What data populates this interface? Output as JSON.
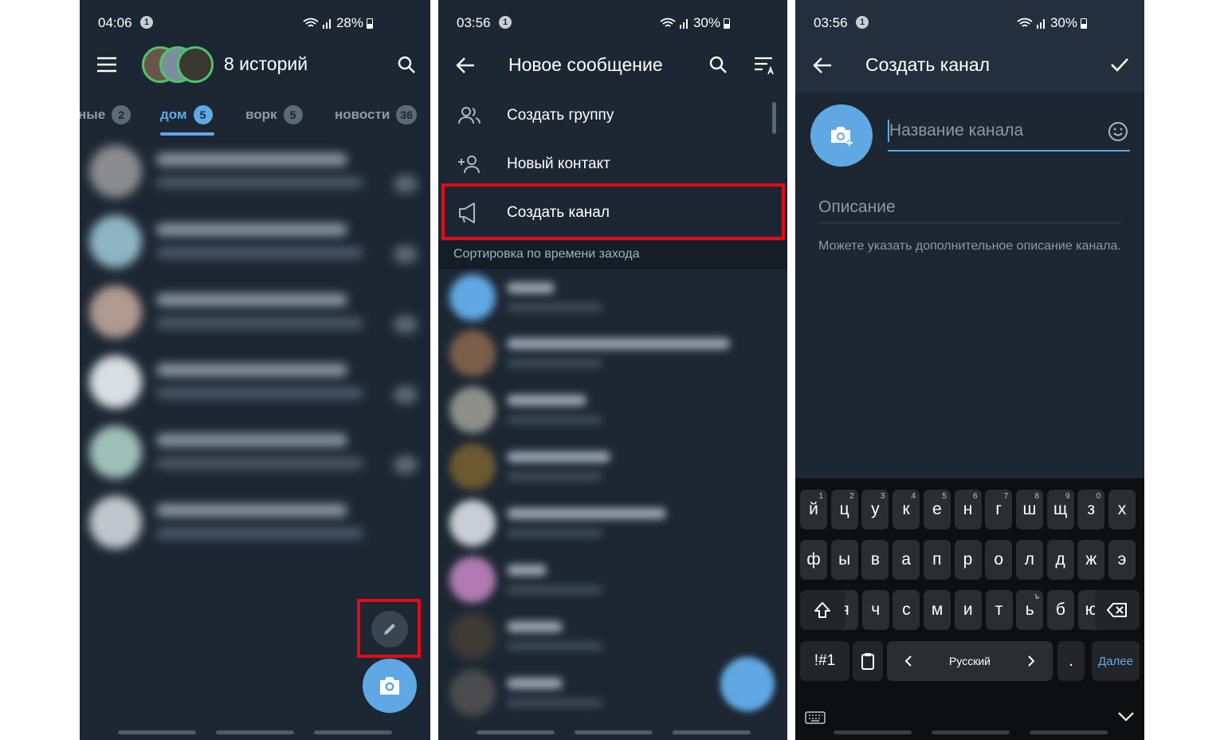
{
  "screens": {
    "chats": {
      "status": {
        "time": "04:06",
        "notif_count": "1",
        "battery": "28%"
      },
      "title": "8 историй",
      "tabs": [
        {
          "label": "ные",
          "count": "2"
        },
        {
          "label": "дом",
          "count": "5"
        },
        {
          "label": "ворк",
          "count": "5"
        },
        {
          "label": "новости",
          "count": "36"
        }
      ]
    },
    "new_message": {
      "status": {
        "time": "03:56",
        "notif_count": "1",
        "battery": "30%"
      },
      "title": "Новое сообщение",
      "menu": [
        {
          "label": "Создать группу",
          "icon": "group-icon"
        },
        {
          "label": "Новый контакт",
          "icon": "add-contact-icon"
        },
        {
          "label": "Создать канал",
          "icon": "megaphone-icon"
        }
      ],
      "section_header": "Сортировка по времени захода"
    },
    "create_channel": {
      "status": {
        "time": "03:56",
        "notif_count": "1",
        "battery": "30%"
      },
      "title": "Создать канал",
      "name_placeholder": "Название канала",
      "description_placeholder": "Описание",
      "description_hint": "Можете указать дополнительное описание канала.",
      "keyboard": {
        "row1": [
          [
            "й",
            "1"
          ],
          [
            "ц",
            "2"
          ],
          [
            "у",
            "3"
          ],
          [
            "к",
            "4"
          ],
          [
            "е",
            "5"
          ],
          [
            "н",
            "6"
          ],
          [
            "г",
            "7"
          ],
          [
            "ш",
            "8"
          ],
          [
            "щ",
            "9"
          ],
          [
            "з",
            "0"
          ],
          [
            "х",
            ""
          ]
        ],
        "row2": [
          "ф",
          "ы",
          "в",
          "а",
          "п",
          "р",
          "о",
          "л",
          "д",
          "ж",
          "э"
        ],
        "row3": [
          [
            "я",
            ""
          ],
          [
            "ч",
            ""
          ],
          [
            "с",
            ""
          ],
          [
            "м",
            ""
          ],
          [
            "и",
            ""
          ],
          [
            "т",
            ""
          ],
          [
            "ь",
            "ъ"
          ],
          [
            "б",
            ""
          ],
          [
            "ю",
            ""
          ]
        ],
        "symbols_label": "!#1",
        "language_label": "Русский",
        "period_label": ".",
        "next_label": "Далее"
      }
    }
  },
  "colors": {
    "accent": "#5ea9e6",
    "background": "#1d2733",
    "highlight": "#e30b17",
    "fab": "#5fa8e3"
  }
}
